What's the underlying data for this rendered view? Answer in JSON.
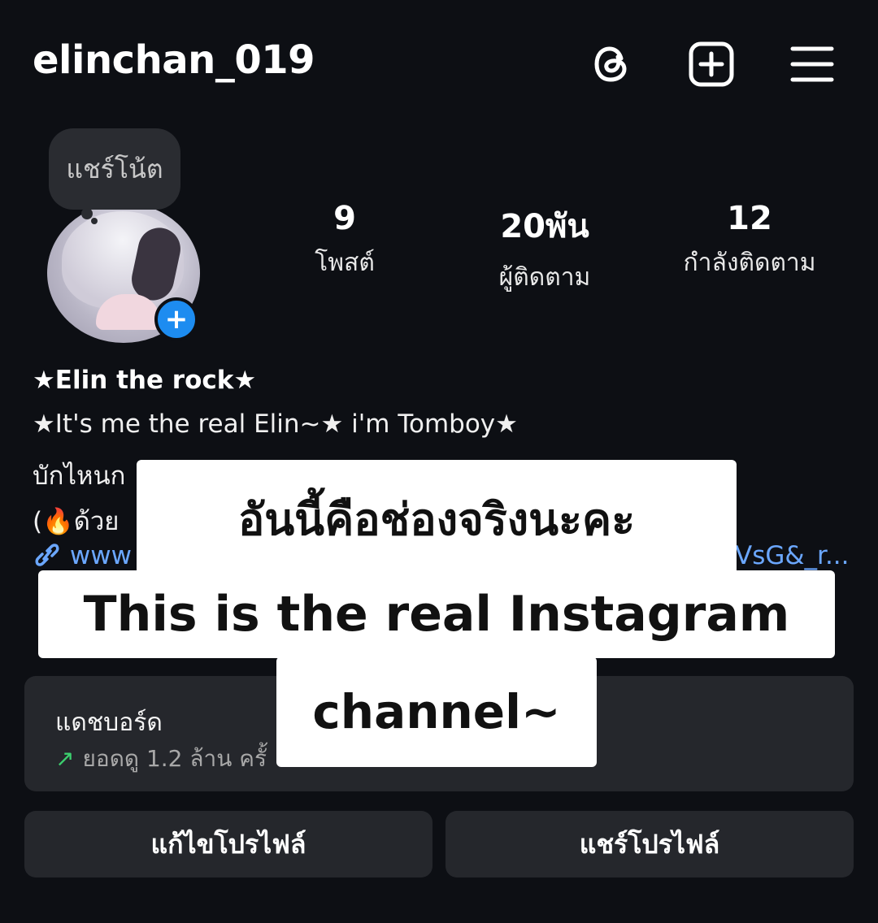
{
  "header": {
    "username": "elinchan_019",
    "icons": [
      "threads-icon",
      "add-post-icon",
      "menu-icon"
    ]
  },
  "note": {
    "label": "แชร์โน้ต"
  },
  "stats": [
    {
      "value": "9",
      "label": "โพสต์"
    },
    {
      "value": "20พัน",
      "label": "ผู้ติดตาม"
    },
    {
      "value": "12",
      "label": "กำลังติดตาม"
    }
  ],
  "profile": {
    "display_name": "★Elin the rock★",
    "bio_line1": "★It's me the real Elin~★ i'm Tomboy★",
    "bio_line2": " บักไหนก",
    "bio_line3": "(🔥ด้วย",
    "link_prefix": "www",
    "link_suffix": "VsG&_r..."
  },
  "dashboard": {
    "title": "แดชบอร์ด",
    "subtitle": "ยอดดู 1.2 ล้าน ครั้"
  },
  "buttons": {
    "edit_profile": "แก้ไขโปรไฟล์",
    "share_profile": "แชร์โปรไฟล์"
  },
  "captions": {
    "line1": "อันนี้คือช่องจริงนะคะ",
    "line2": "This is the real Instagram",
    "line3": "channel~"
  },
  "colors": {
    "background": "#0d0f14",
    "accent_blue": "#1d8cf0",
    "link_blue": "#6ba7ff",
    "trend_green": "#3ccf6e"
  }
}
